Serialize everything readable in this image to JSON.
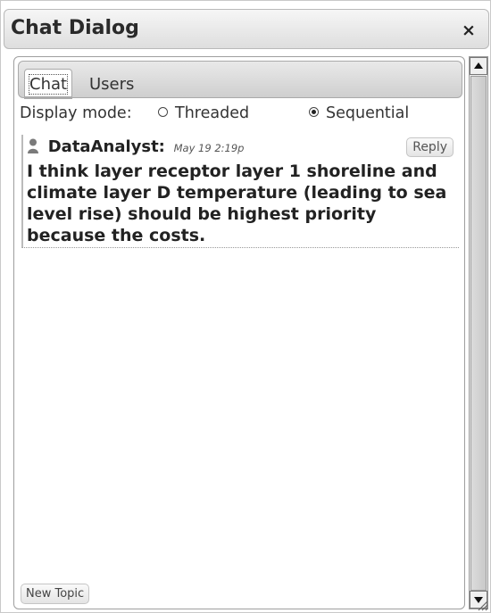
{
  "dialog": {
    "title": "Chat Dialog",
    "close_icon": "close-icon",
    "close_glyph": "×"
  },
  "tabs": [
    {
      "label": "Chat",
      "active": true
    },
    {
      "label": "Users",
      "active": false
    }
  ],
  "display_mode": {
    "label": "Display mode:",
    "options": [
      {
        "label": "Threaded",
        "checked": false
      },
      {
        "label": "Sequential",
        "checked": true
      }
    ]
  },
  "messages": [
    {
      "author": "DataAnalyst:",
      "timestamp": "May 19 2:19p",
      "reply_label": "Reply",
      "user_icon": "user-icon",
      "body": "I think layer receptor layer 1 shoreline and climate layer D temperature (leading to sea level rise) should be highest priority because the costs."
    }
  ],
  "footer": {
    "new_topic_label": "New Topic"
  },
  "colors": {
    "titlebar_top": "#f6f6f6",
    "titlebar_bottom": "#dedede",
    "text": "#222222",
    "border": "#aaaaaa"
  }
}
